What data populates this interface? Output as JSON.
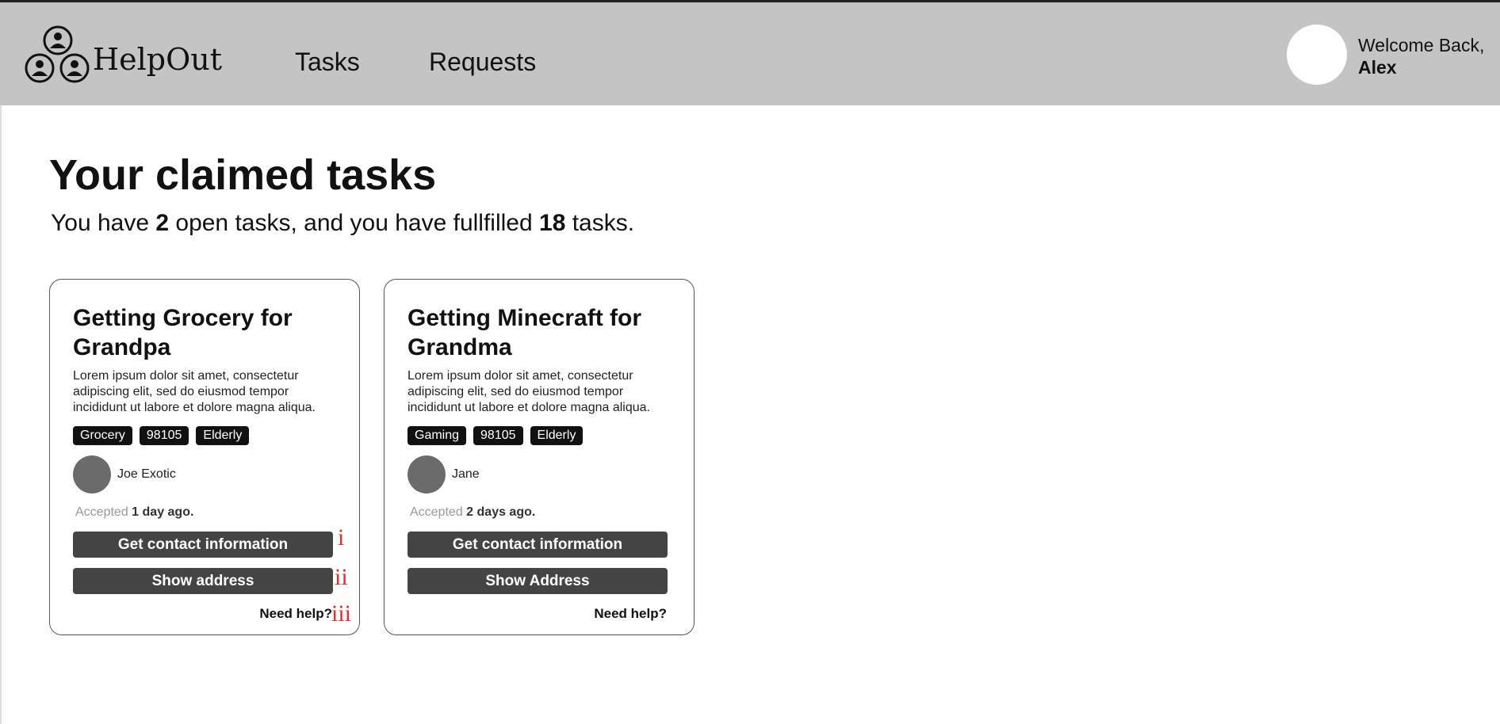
{
  "app": {
    "brand": "HelpOut"
  },
  "nav": {
    "tasks": "Tasks",
    "requests": "Requests"
  },
  "user": {
    "welcome": "Welcome Back,",
    "name": "Alex"
  },
  "page": {
    "title": "Your claimed tasks",
    "summary_prefix": "You have ",
    "open_count": "2",
    "summary_middle": " open tasks, and you have fullfilled ",
    "fulfilled_count": "18",
    "summary_suffix": " tasks."
  },
  "cards": [
    {
      "title": "Getting Grocery for Grandpa",
      "description": "Lorem ipsum dolor sit amet, consectetur adipiscing elit, sed do eiusmod tempor incididunt ut labore et dolore magna aliqua.",
      "tags": [
        "Grocery",
        "98105",
        "Elderly"
      ],
      "person": "Joe Exotic",
      "accepted_label": "Accepted",
      "accepted_time": "1 day ago.",
      "contact_button": "Get contact information",
      "address_button": "Show address",
      "help_link": "Need help?"
    },
    {
      "title": "Getting Minecraft for Grandma",
      "description": "Lorem ipsum dolor sit amet, consectetur adipiscing elit, sed do eiusmod tempor incididunt ut labore et dolore magna aliqua.",
      "tags": [
        "Gaming",
        "98105",
        "Elderly"
      ],
      "person": "Jane",
      "accepted_label": "Accepted",
      "accepted_time": "2 days ago.",
      "contact_button": "Get contact information",
      "address_button": "Show Address",
      "help_link": "Need help?"
    }
  ],
  "annotations": [
    "i",
    "ii",
    "iii"
  ],
  "colors": {
    "nav_bg": "#c4c4c4",
    "button_bg": "#444444",
    "tag_bg": "#111111",
    "annotation": "#e03030"
  }
}
